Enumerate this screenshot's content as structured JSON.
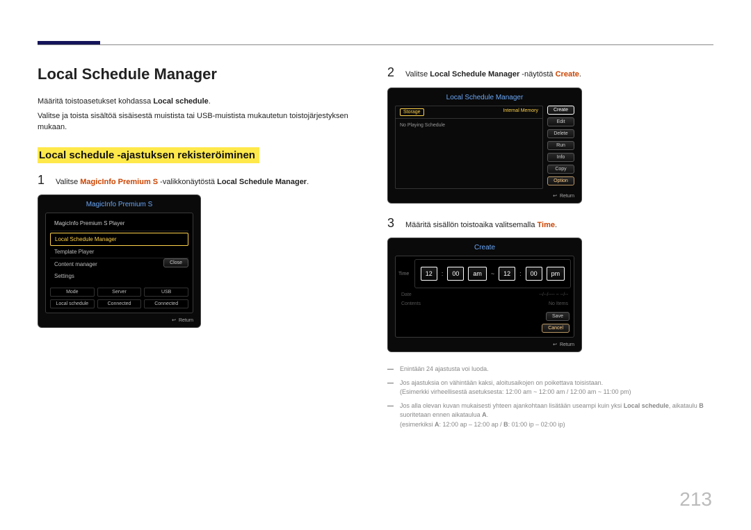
{
  "page_number": "213",
  "title": "Local Schedule Manager",
  "intro": {
    "line1_prefix": "Määritä toistoasetukset kohdassa ",
    "line1_bold": "Local schedule",
    "line1_suffix": ".",
    "line2": "Valitse ja toista sisältöä sisäisestä muistista tai USB-muistista mukautetun toistojärjestyksen mukaan."
  },
  "subheading": "Local schedule -ajastuksen rekisteröiminen",
  "step1": {
    "num": "1",
    "prefix": "Valitse ",
    "accent1": "MagicInfo Premium S",
    "mid": " -valikkonäytöstä ",
    "bold": "Local Schedule Manager",
    "suffix": "."
  },
  "step2": {
    "num": "2",
    "prefix": "Valitse ",
    "bold1": "Local Schedule Manager",
    "mid": " -näytöstä ",
    "accent": "Create",
    "suffix": "."
  },
  "step3": {
    "num": "3",
    "prefix": "Määritä sisällön toistoaika valitsemalla ",
    "accent": "Time",
    "suffix": "."
  },
  "panelA": {
    "title": "MagicInfo Premium S",
    "player": "MagicInfo Premium S Player",
    "item_sel": "Local Schedule Manager",
    "item2": "Template Player",
    "item3": "Content manager",
    "item4": "Settings",
    "close": "Close",
    "status": {
      "c1": "Mode",
      "c2": "Server",
      "c3": "USB",
      "c4": "Local schedule",
      "c5": "Connected",
      "c6": "Connected"
    },
    "return": "Return"
  },
  "panelB": {
    "title": "Local Schedule Manager",
    "storage": "Storage",
    "internal": "Internal Memory",
    "noplay": "No Playing Schedule",
    "buttons": {
      "create": "Create",
      "edit": "Edit",
      "delete": "Delete",
      "run": "Run",
      "info": "Info",
      "copy": "Copy",
      "option": "Option"
    },
    "return": "Return"
  },
  "panelC": {
    "title": "Create",
    "row_label_left": "Time",
    "t1": "12",
    "t2": "00",
    "ampm1": "am",
    "tilde": "~",
    "t3": "12",
    "t4": "00",
    "ampm2": "pm",
    "row2l": "Date",
    "row2r": "--/--/---- ~ --/--",
    "row3l": "Contents",
    "row3r": "No Items",
    "save": "Save",
    "cancel": "Cancel",
    "return": "Return"
  },
  "notes": {
    "n1": "Enintään 24 ajastusta voi luoda.",
    "n2a": "Jos ajastuksia on vähintään kaksi, aloitusaikojen on poikettava toisistaan.",
    "n2b": "(Esimerkki virheellisestä asetuksesta: 12:00 am ~ 12:00 am / 12:00 am ~ 11:00 pm)",
    "n3a_pre": "Jos alla olevan kuvan mukaisesti yhteen ajankohtaan lisätään useampi kuin yksi ",
    "n3a_bold1": "Local schedule",
    "n3a_mid": ", aikataulu ",
    "n3a_bold2": "B",
    "n3a_suf": " suoritetaan ennen aikataulua ",
    "n3a_bold3": "A",
    "n3a_end": ".",
    "n3b_pre": "(esimerkiksi ",
    "n3b_bA": "A",
    "n3b_mid1": ": 12:00 ap – 12:00 ap / ",
    "n3b_bB": "B",
    "n3b_mid2": ": 01:00 ip – 02:00 ip)"
  }
}
